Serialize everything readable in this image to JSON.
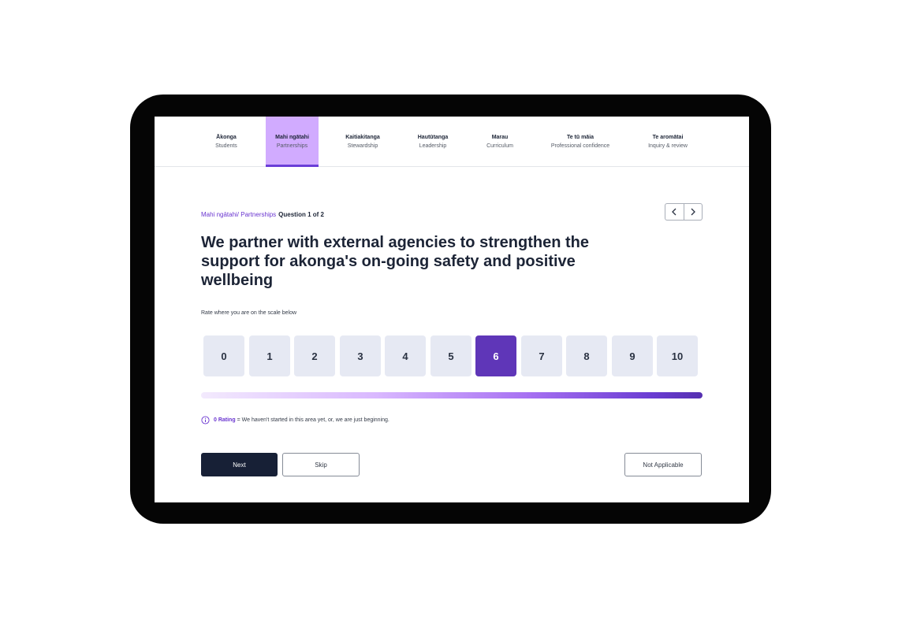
{
  "tabs": [
    {
      "maori": "Ākonga",
      "english": "Students"
    },
    {
      "maori": "Mahi ngātahi",
      "english": "Partnerships"
    },
    {
      "maori": "Kaitiakitanga",
      "english": "Stewardship"
    },
    {
      "maori": "Hautūtanga",
      "english": "Leadership"
    },
    {
      "maori": "Marau",
      "english": "Curriculum"
    },
    {
      "maori": "Te tū māia",
      "english": "Professional confidence"
    },
    {
      "maori": "Te aromātai",
      "english": "Inquiry & review"
    }
  ],
  "active_tab": "Mahi ngātahi",
  "breadcrumb": {
    "section": "Mahi ngātahi/ Partnerships",
    "question_progress": "Question 1 of 2"
  },
  "nav": {
    "prev_icon": "chevron-left-icon",
    "next_icon": "chevron-right-icon"
  },
  "question": {
    "text": "We partner with external agencies to strengthen the support for akonga's on-going safety and positive wellbeing"
  },
  "scale": {
    "label": "Rate where you are on the scale below",
    "options": [
      "0",
      "1",
      "2",
      "3",
      "4",
      "5",
      "6",
      "7",
      "8",
      "9",
      "10"
    ],
    "selected": "6"
  },
  "info": {
    "icon": "info-icon",
    "rating_key": "0 Rating",
    "rating_text": "= We haven't started in this area yet, or, we are just beginning."
  },
  "buttons": {
    "next": "Next",
    "skip": "Skip",
    "not_applicable": "Not Applicable"
  },
  "colors": {
    "accent": "#6a35d0",
    "selected": "#5f36b8",
    "active_tab_bg": "#d1abff",
    "primary_button": "#172036"
  }
}
